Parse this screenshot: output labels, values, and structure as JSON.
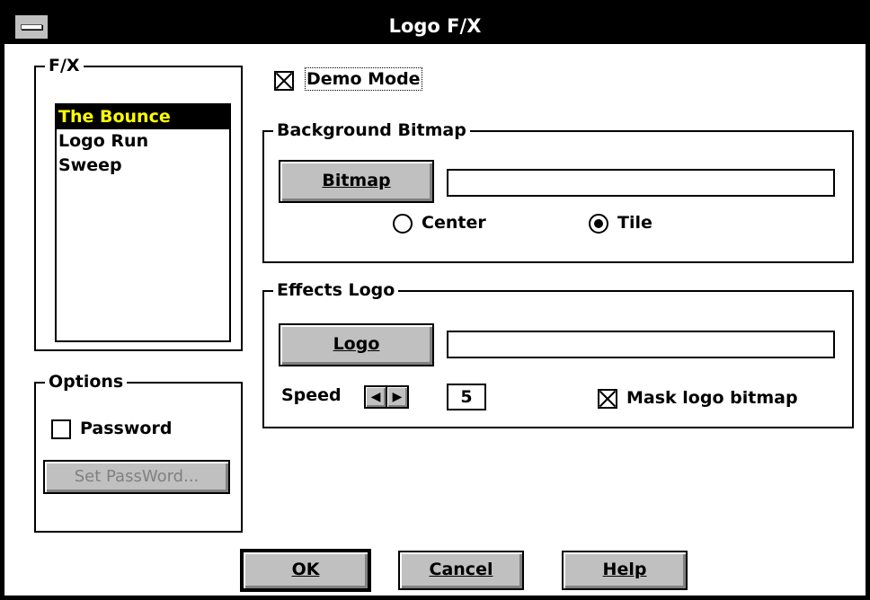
{
  "window": {
    "title": "Logo F/X"
  },
  "fx_group": {
    "label": "F/X",
    "items": [
      {
        "label": "The Bounce",
        "selected": true
      },
      {
        "label": "Logo Run",
        "selected": false
      },
      {
        "label": "Sweep",
        "selected": false
      }
    ]
  },
  "demo_mode": {
    "label": "Demo Mode",
    "checked": true
  },
  "background_bitmap": {
    "label": "Background Bitmap",
    "button_label": "Bitmap",
    "path_value": "",
    "center_label": "Center",
    "tile_label": "Tile",
    "selected": "Tile"
  },
  "effects_logo": {
    "label": "Effects Logo",
    "button_label": "Logo",
    "path_value": "",
    "speed_label": "Speed",
    "speed_value": "5",
    "mask_label": "Mask logo bitmap",
    "mask_checked": true
  },
  "options": {
    "label": "Options",
    "password_label": "Password",
    "password_checked": false,
    "set_password_label": "Set PassWord..."
  },
  "footer": {
    "ok_label": "OK",
    "cancel_label": "Cancel",
    "help_label": "Help"
  },
  "colors": {
    "face": "#c0c0c0",
    "selection_bg": "#000000",
    "selection_text": "#ffff00",
    "disabled_text": "#808080"
  }
}
